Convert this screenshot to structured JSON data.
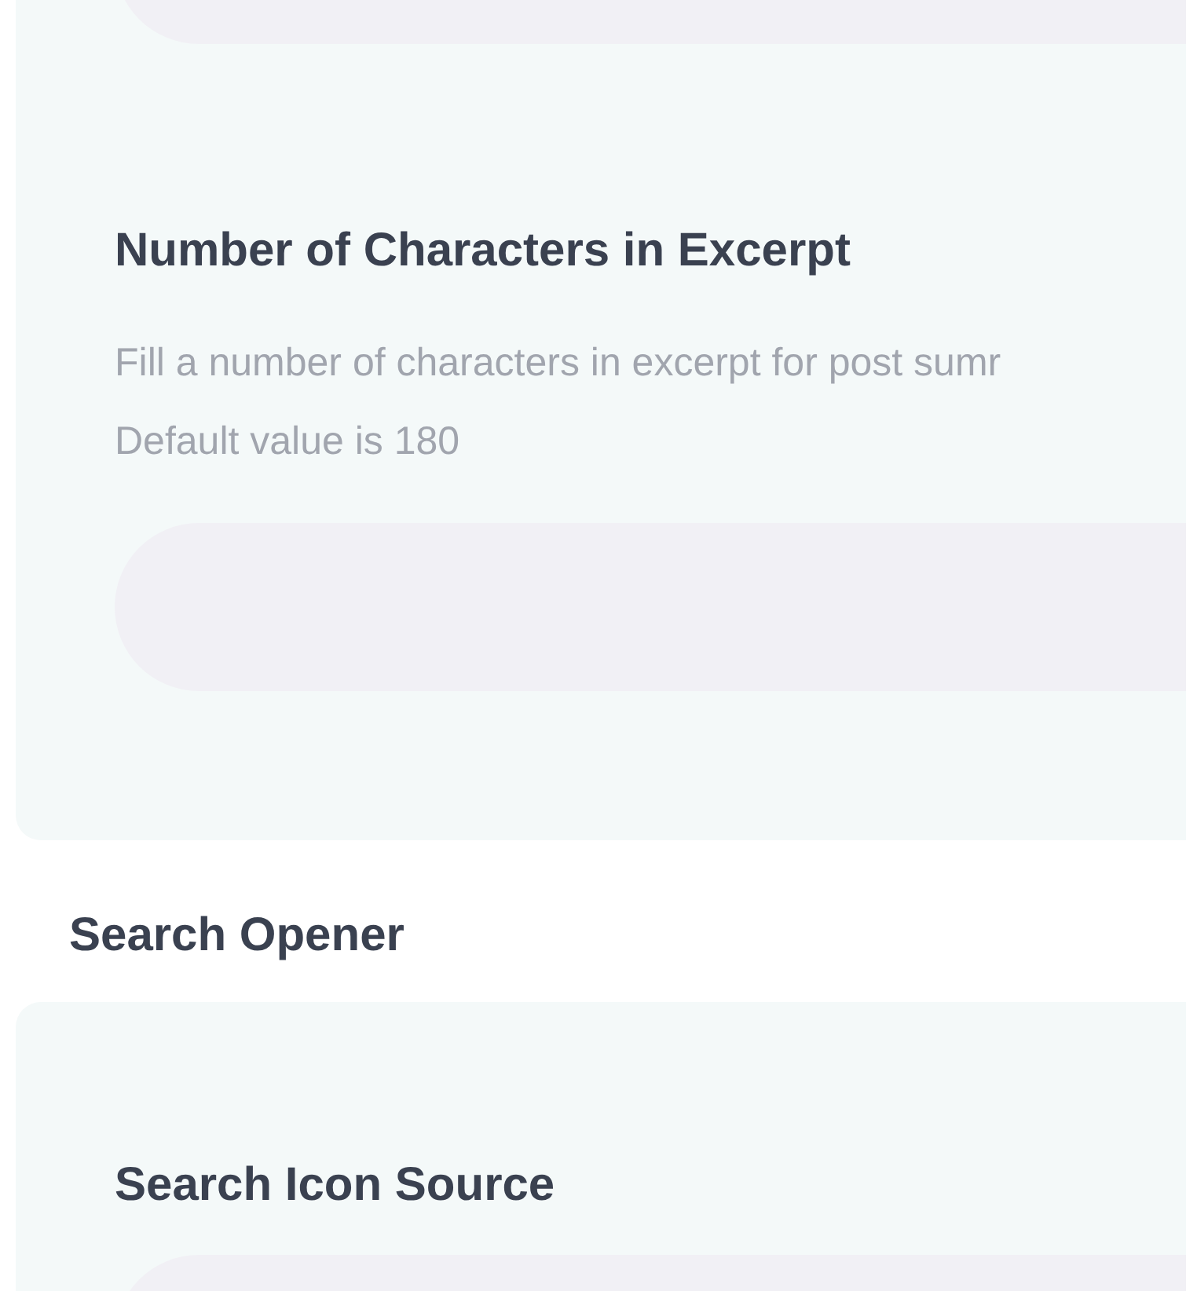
{
  "blocks": [
    {
      "kind": "panel",
      "items": [
        {
          "kind": "field"
        },
        {
          "kind": "title",
          "text": "Number of Characters in Excerpt"
        },
        {
          "kind": "description",
          "lines": [
            "Fill a number of characters in excerpt for post sumr",
            "Default value is 180"
          ]
        },
        {
          "kind": "field"
        }
      ]
    },
    {
      "kind": "heading",
      "text": "Search Opener"
    },
    {
      "kind": "panel",
      "items": [
        {
          "kind": "title",
          "text": "Search Icon Source"
        },
        {
          "kind": "field"
        }
      ]
    }
  ]
}
